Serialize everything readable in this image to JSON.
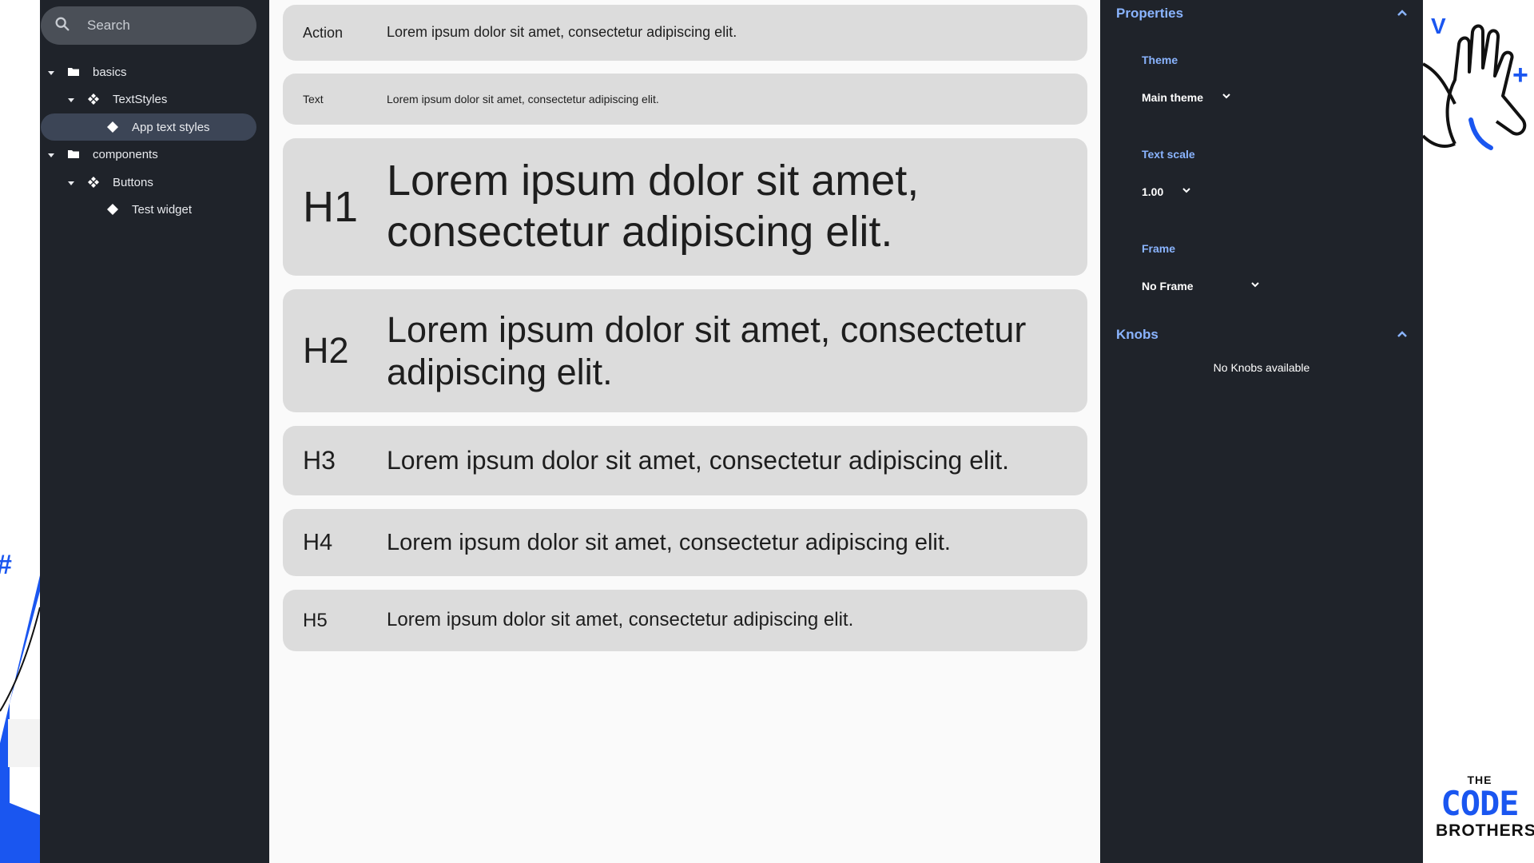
{
  "search": {
    "placeholder": "Search"
  },
  "tree": [
    {
      "label": "basics"
    },
    {
      "label": "TextStyles"
    },
    {
      "label": "App text styles"
    },
    {
      "label": "components"
    },
    {
      "label": "Buttons"
    },
    {
      "label": "Test widget"
    }
  ],
  "rows": [
    {
      "label": "Action",
      "text": "Lorem ipsum dolor sit amet, consectetur adipiscing elit."
    },
    {
      "label": "Text",
      "text": "Lorem ipsum dolor sit amet, consectetur adipiscing elit."
    },
    {
      "label": "H1",
      "text": "Lorem ipsum dolor sit amet, consectetur adipiscing elit."
    },
    {
      "label": "H2",
      "text": "Lorem ipsum dolor sit amet, consectetur adipiscing elit."
    },
    {
      "label": "H3",
      "text": "Lorem ipsum dolor sit amet, consectetur adipiscing elit."
    },
    {
      "label": "H4",
      "text": "Lorem ipsum dolor sit amet, consectetur adipiscing elit."
    },
    {
      "label": "H5",
      "text": "Lorem ipsum dolor sit amet, consectetur adipiscing elit."
    }
  ],
  "properties": {
    "title": "Properties",
    "theme_label": "Theme",
    "theme_value": "Main theme",
    "text_scale_label": "Text scale",
    "text_scale_value": "1.00",
    "frame_label": "Frame",
    "frame_value": "No Frame"
  },
  "knobs": {
    "title": "Knobs",
    "empty": "No Knobs available"
  },
  "brand": {
    "line1": "THE",
    "line2": "CODE",
    "line3": "BROTHERS"
  },
  "colors": {
    "sidebar_bg": "#1f232a",
    "accent": "#8ab4ff",
    "row_bg": "#dcdcdc",
    "brand_blue": "#1a56f0"
  }
}
